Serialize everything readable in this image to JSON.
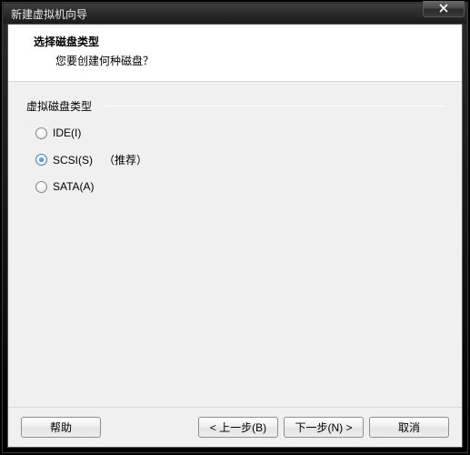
{
  "window": {
    "title": "新建虚拟机向导"
  },
  "header": {
    "title": "选择磁盘类型",
    "subtitle": "您要创建何种磁盘？"
  },
  "group": {
    "label": "虚拟磁盘类型"
  },
  "options": {
    "ide": {
      "label": "IDE(I)"
    },
    "scsi": {
      "label": "SCSI(S)",
      "recommended": "（推荐）"
    },
    "sata": {
      "label": "SATA(A)"
    }
  },
  "selected_option": "scsi",
  "footer": {
    "help": "帮助",
    "back": "< 上一步(B)",
    "next": "下一步(N) >",
    "cancel": "取消"
  }
}
